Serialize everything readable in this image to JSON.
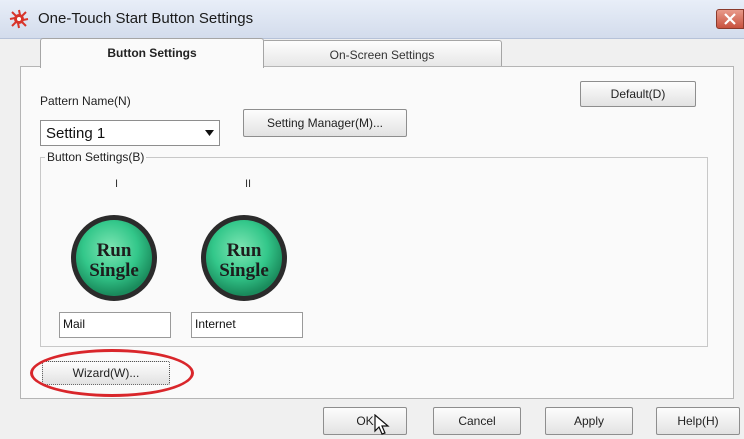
{
  "window": {
    "title": "One-Touch Start Button Settings"
  },
  "tabs": [
    {
      "label": "Button Settings",
      "active": true
    },
    {
      "label": "On-Screen Settings",
      "active": false
    }
  ],
  "pattern": {
    "label": "Pattern Name(N)",
    "selected": "Setting 1"
  },
  "buttons": {
    "default": "Default(D)",
    "setting_manager": "Setting Manager(M)...",
    "wizard": "Wizard(W)...",
    "ok": "OK",
    "cancel": "Cancel",
    "apply": "Apply",
    "help": "Help(H)"
  },
  "group": {
    "label": "Button Settings(B)"
  },
  "slots": [
    {
      "index_label": "I",
      "icon_line1": "Run",
      "icon_line2": "Single",
      "name": "Mail"
    },
    {
      "index_label": "II",
      "icon_line1": "Run",
      "icon_line2": "Single",
      "name": "Internet"
    }
  ],
  "colors": {
    "run_button_green": "#33c78a",
    "highlight_red": "#d9262b"
  },
  "icons": {
    "app": "app-icon",
    "close": "close-icon",
    "dropdown": "chevron-down-icon",
    "cursor": "mouse-pointer-icon"
  }
}
